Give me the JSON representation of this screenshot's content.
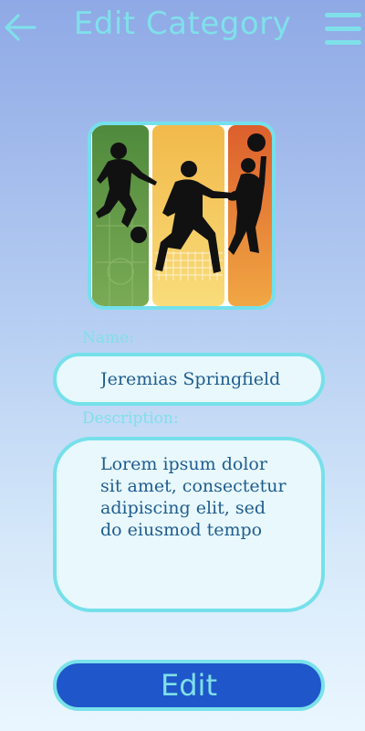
{
  "header": {
    "title": "Edit Category",
    "back_icon": "arrow-left-icon",
    "menu_icon": "hamburger-menu-icon"
  },
  "category_image": {
    "icon": "sports-silhouettes-image",
    "panel_colors": [
      "#5f9546",
      "#f3c45d",
      "#e26c34"
    ]
  },
  "form": {
    "name_label": "Name:",
    "name_value": "Jeremias Springfield",
    "description_label": "Description:",
    "description_value": "Lorem ipsum dolor sit amet, consectetur adipiscing elit, sed do eiusmod tempo"
  },
  "actions": {
    "edit_label": "Edit"
  },
  "colors": {
    "accent": "#76e0ea",
    "button": "#1f56c9",
    "input_bg": "#e8f8fd",
    "input_text": "#1f5d8f"
  }
}
